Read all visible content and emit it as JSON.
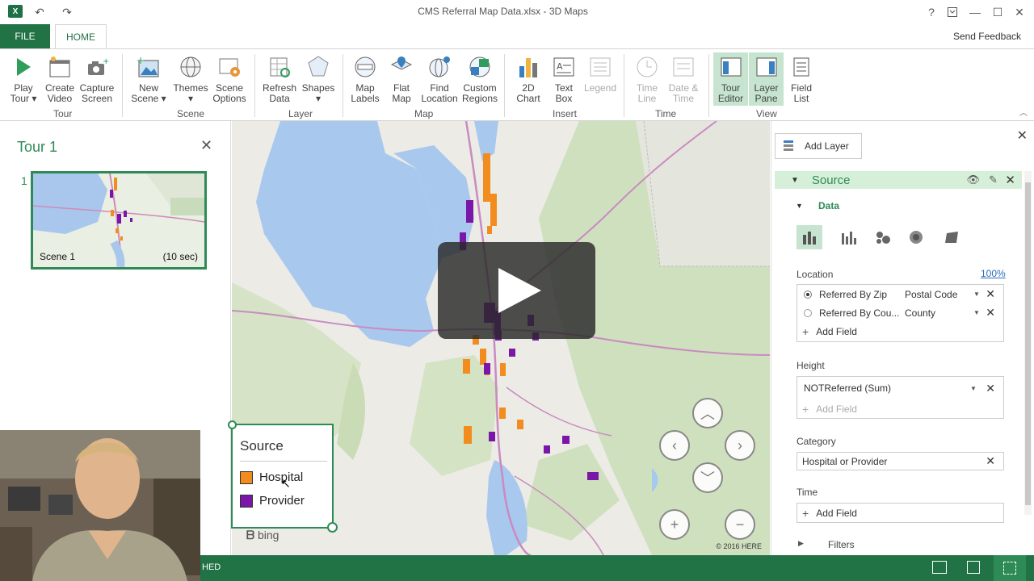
{
  "window": {
    "title": "CMS Referral Map Data.xlsx - 3D Maps",
    "help_label": "?",
    "restore_icon": "restore-ribbon-icon",
    "minimize_label": "—",
    "maximize_label": "☐",
    "close_label": "✕"
  },
  "tabs": {
    "file": "FILE",
    "home": "HOME",
    "send_feedback": "Send Feedback"
  },
  "ribbon": {
    "tour": {
      "label": "Tour",
      "play_tour": [
        "Play",
        "Tour ▾"
      ],
      "create_video": [
        "Create",
        "Video"
      ],
      "capture_screen": [
        "Capture",
        "Screen"
      ]
    },
    "scene": {
      "label": "Scene",
      "new_scene": [
        "New",
        "Scene ▾"
      ],
      "themes": [
        "Themes",
        "▾"
      ],
      "scene_options": [
        "Scene",
        "Options"
      ]
    },
    "layer": {
      "label": "Layer",
      "refresh_data": [
        "Refresh",
        "Data"
      ],
      "shapes": [
        "Shapes",
        "▾"
      ]
    },
    "map": {
      "label": "Map",
      "map_labels": [
        "Map",
        "Labels"
      ],
      "flat_map": [
        "Flat",
        "Map"
      ],
      "find_location": [
        "Find",
        "Location"
      ],
      "custom_regions": [
        "Custom",
        "Regions"
      ]
    },
    "insert": {
      "label": "Insert",
      "chart_2d": [
        "2D",
        "Chart"
      ],
      "text_box": [
        "Text",
        "Box"
      ],
      "legend": [
        "Legend",
        ""
      ]
    },
    "time": {
      "label": "Time",
      "time_line": [
        "Time",
        "Line"
      ],
      "date_time": [
        "Date &",
        "Time"
      ]
    },
    "view": {
      "label": "View",
      "tour_editor": [
        "Tour",
        "Editor"
      ],
      "layer_pane": [
        "Layer",
        "Pane"
      ],
      "field_list": [
        "Field",
        "List"
      ]
    }
  },
  "tour_pane": {
    "title": "Tour 1",
    "close": "✕",
    "scene_number": "1",
    "scene_name": "Scene 1",
    "scene_duration": "(10 sec)"
  },
  "legend": {
    "title": "Source",
    "items": [
      {
        "label": "Hospital",
        "color": "#f28c1e"
      },
      {
        "label": "Provider",
        "color": "#7a16a8"
      }
    ]
  },
  "map": {
    "attribution": "© 2016 HERE",
    "bing": "bing",
    "hospital_color": "#f28c1e",
    "provider_color": "#7a16a8"
  },
  "layer_pane": {
    "close": "✕",
    "add_layer": "Add Layer",
    "layer_name": "Source",
    "data_section": "Data",
    "location_label": "Location",
    "location_confidence": "100%",
    "location_fields": [
      {
        "field": "Referred By Zip",
        "type": "Postal Code",
        "selected": true
      },
      {
        "field": "Referred By Cou...",
        "type": "County",
        "selected": false
      }
    ],
    "add_field": "Add Field",
    "height_label": "Height",
    "height_field": "NOTReferred (Sum)",
    "category_label": "Category",
    "category_field": "Hospital or Provider",
    "time_label": "Time",
    "filters_label": "Filters"
  },
  "status_bar": {
    "text": "HED"
  },
  "colors": {
    "accent": "#217346",
    "accent_light": "#c6e4cf",
    "link": "#2e8b57"
  }
}
